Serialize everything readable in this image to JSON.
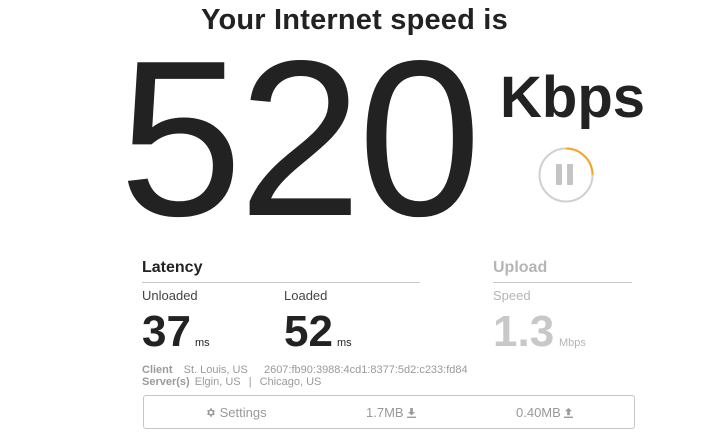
{
  "headline": "Your Internet speed is",
  "speed": {
    "value": "520",
    "unit": "Kbps"
  },
  "pause_button": {
    "icon": "pause-icon",
    "accent": "#f5a623"
  },
  "latency": {
    "title": "Latency",
    "unloaded": {
      "label": "Unloaded",
      "value": "37",
      "unit": "ms"
    },
    "loaded": {
      "label": "Loaded",
      "value": "52",
      "unit": "ms"
    }
  },
  "upload": {
    "title": "Upload",
    "speed_label": "Speed",
    "value": "1.3",
    "unit": "Mbps"
  },
  "client": {
    "client_label": "Client",
    "client_location": "St. Louis, US",
    "client_ip": "2607:fb90:3988:4cd1:8377:5d2:c233:fd84",
    "servers_label": "Server(s)",
    "server_1": "Elgin, US",
    "separator": "|",
    "server_2": "Chicago, US"
  },
  "toolbar": {
    "settings_label": "Settings",
    "settings_icon": "gear-icon",
    "download_data": "1.7MB",
    "upload_data": "0.40MB",
    "data_icon": "download-arrow-icon"
  },
  "colors": {
    "text": "#222222",
    "muted": "#b5b5b5",
    "accent": "#f5a623"
  }
}
